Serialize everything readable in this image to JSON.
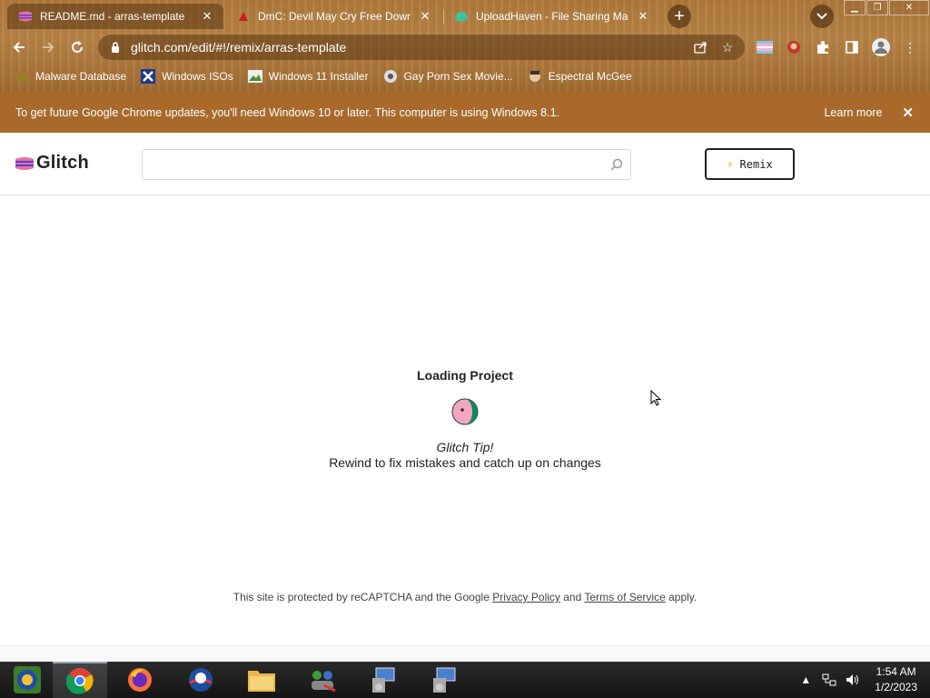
{
  "browser": {
    "tabs": [
      {
        "title": "README.md - arras-template",
        "active": true
      },
      {
        "title": "DmC: Devil May Cry Free Downloa",
        "active": false
      },
      {
        "title": "UploadHaven - File Sharing Made",
        "active": false
      }
    ],
    "url": "glitch.com/edit/#!/remix/arras-template",
    "bookmarks": [
      {
        "label": "Malware Database"
      },
      {
        "label": "Windows ISOs"
      },
      {
        "label": "Windows 11 Installer"
      },
      {
        "label": "Gay Porn Sex Movie..."
      },
      {
        "label": "Espectral McGee"
      }
    ],
    "infobar": {
      "message": "To get future Google Chrome updates, you'll need Windows 10 or later. This computer is using Windows 8.1.",
      "learn_more": "Learn more",
      "close": "✕"
    }
  },
  "glitch": {
    "logo_text": "Glitch",
    "search_placeholder": "",
    "remix_label": "Remix",
    "loading_title": "Loading Project",
    "tip_label": "Glitch Tip!",
    "tip_text": "Rewind to fix mistakes and catch up on changes",
    "recaptcha": {
      "prefix": "This site is protected by reCAPTCHA and the Google",
      "privacy": "Privacy Policy",
      "and": "and",
      "terms": "Terms of Service",
      "suffix": "apply."
    }
  },
  "taskbar": {
    "time": "1:54 AM",
    "date": "1/2/2023"
  },
  "colors": {
    "chrome_theme": "#b07a3c",
    "infobar": "#a8692a",
    "glitch_pink": "#f2a6c3",
    "glitch_green": "#0f8a5f",
    "remix_bolt": "#f5a623"
  }
}
